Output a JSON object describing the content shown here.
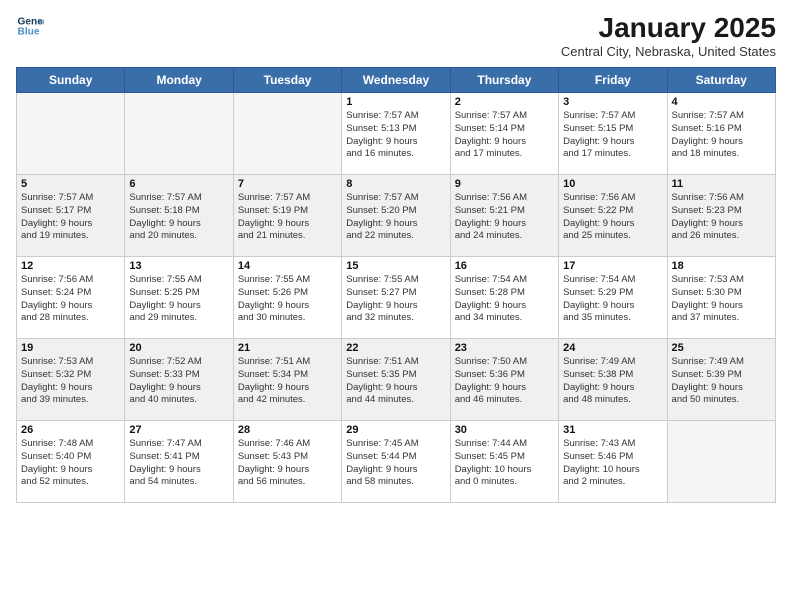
{
  "logo": {
    "line1": "General",
    "line2": "Blue"
  },
  "title": "January 2025",
  "location": "Central City, Nebraska, United States",
  "headers": [
    "Sunday",
    "Monday",
    "Tuesday",
    "Wednesday",
    "Thursday",
    "Friday",
    "Saturday"
  ],
  "weeks": [
    [
      {
        "day": "",
        "text": "",
        "empty": true
      },
      {
        "day": "",
        "text": "",
        "empty": true
      },
      {
        "day": "",
        "text": "",
        "empty": true
      },
      {
        "day": "1",
        "text": "Sunrise: 7:57 AM\nSunset: 5:13 PM\nDaylight: 9 hours\nand 16 minutes."
      },
      {
        "day": "2",
        "text": "Sunrise: 7:57 AM\nSunset: 5:14 PM\nDaylight: 9 hours\nand 17 minutes."
      },
      {
        "day": "3",
        "text": "Sunrise: 7:57 AM\nSunset: 5:15 PM\nDaylight: 9 hours\nand 17 minutes."
      },
      {
        "day": "4",
        "text": "Sunrise: 7:57 AM\nSunset: 5:16 PM\nDaylight: 9 hours\nand 18 minutes."
      }
    ],
    [
      {
        "day": "5",
        "text": "Sunrise: 7:57 AM\nSunset: 5:17 PM\nDaylight: 9 hours\nand 19 minutes."
      },
      {
        "day": "6",
        "text": "Sunrise: 7:57 AM\nSunset: 5:18 PM\nDaylight: 9 hours\nand 20 minutes."
      },
      {
        "day": "7",
        "text": "Sunrise: 7:57 AM\nSunset: 5:19 PM\nDaylight: 9 hours\nand 21 minutes."
      },
      {
        "day": "8",
        "text": "Sunrise: 7:57 AM\nSunset: 5:20 PM\nDaylight: 9 hours\nand 22 minutes."
      },
      {
        "day": "9",
        "text": "Sunrise: 7:56 AM\nSunset: 5:21 PM\nDaylight: 9 hours\nand 24 minutes."
      },
      {
        "day": "10",
        "text": "Sunrise: 7:56 AM\nSunset: 5:22 PM\nDaylight: 9 hours\nand 25 minutes."
      },
      {
        "day": "11",
        "text": "Sunrise: 7:56 AM\nSunset: 5:23 PM\nDaylight: 9 hours\nand 26 minutes."
      }
    ],
    [
      {
        "day": "12",
        "text": "Sunrise: 7:56 AM\nSunset: 5:24 PM\nDaylight: 9 hours\nand 28 minutes."
      },
      {
        "day": "13",
        "text": "Sunrise: 7:55 AM\nSunset: 5:25 PM\nDaylight: 9 hours\nand 29 minutes."
      },
      {
        "day": "14",
        "text": "Sunrise: 7:55 AM\nSunset: 5:26 PM\nDaylight: 9 hours\nand 30 minutes."
      },
      {
        "day": "15",
        "text": "Sunrise: 7:55 AM\nSunset: 5:27 PM\nDaylight: 9 hours\nand 32 minutes."
      },
      {
        "day": "16",
        "text": "Sunrise: 7:54 AM\nSunset: 5:28 PM\nDaylight: 9 hours\nand 34 minutes."
      },
      {
        "day": "17",
        "text": "Sunrise: 7:54 AM\nSunset: 5:29 PM\nDaylight: 9 hours\nand 35 minutes."
      },
      {
        "day": "18",
        "text": "Sunrise: 7:53 AM\nSunset: 5:30 PM\nDaylight: 9 hours\nand 37 minutes."
      }
    ],
    [
      {
        "day": "19",
        "text": "Sunrise: 7:53 AM\nSunset: 5:32 PM\nDaylight: 9 hours\nand 39 minutes."
      },
      {
        "day": "20",
        "text": "Sunrise: 7:52 AM\nSunset: 5:33 PM\nDaylight: 9 hours\nand 40 minutes."
      },
      {
        "day": "21",
        "text": "Sunrise: 7:51 AM\nSunset: 5:34 PM\nDaylight: 9 hours\nand 42 minutes."
      },
      {
        "day": "22",
        "text": "Sunrise: 7:51 AM\nSunset: 5:35 PM\nDaylight: 9 hours\nand 44 minutes."
      },
      {
        "day": "23",
        "text": "Sunrise: 7:50 AM\nSunset: 5:36 PM\nDaylight: 9 hours\nand 46 minutes."
      },
      {
        "day": "24",
        "text": "Sunrise: 7:49 AM\nSunset: 5:38 PM\nDaylight: 9 hours\nand 48 minutes."
      },
      {
        "day": "25",
        "text": "Sunrise: 7:49 AM\nSunset: 5:39 PM\nDaylight: 9 hours\nand 50 minutes."
      }
    ],
    [
      {
        "day": "26",
        "text": "Sunrise: 7:48 AM\nSunset: 5:40 PM\nDaylight: 9 hours\nand 52 minutes."
      },
      {
        "day": "27",
        "text": "Sunrise: 7:47 AM\nSunset: 5:41 PM\nDaylight: 9 hours\nand 54 minutes."
      },
      {
        "day": "28",
        "text": "Sunrise: 7:46 AM\nSunset: 5:43 PM\nDaylight: 9 hours\nand 56 minutes."
      },
      {
        "day": "29",
        "text": "Sunrise: 7:45 AM\nSunset: 5:44 PM\nDaylight: 9 hours\nand 58 minutes."
      },
      {
        "day": "30",
        "text": "Sunrise: 7:44 AM\nSunset: 5:45 PM\nDaylight: 10 hours\nand 0 minutes."
      },
      {
        "day": "31",
        "text": "Sunrise: 7:43 AM\nSunset: 5:46 PM\nDaylight: 10 hours\nand 2 minutes."
      },
      {
        "day": "",
        "text": "",
        "empty": true
      }
    ]
  ]
}
